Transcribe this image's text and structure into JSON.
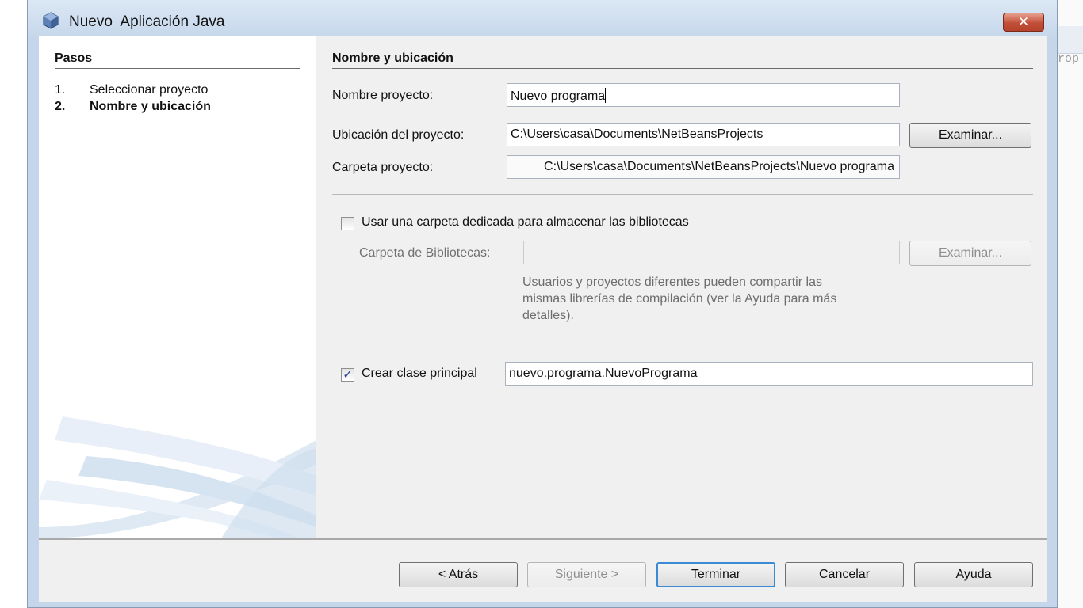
{
  "window": {
    "title": "Nuevo  Aplicación Java",
    "close_label": "✕"
  },
  "steps": {
    "heading": "Pasos",
    "items": [
      {
        "num": "1.",
        "label": "Seleccionar proyecto"
      },
      {
        "num": "2.",
        "label": "Nombre y ubicación"
      }
    ]
  },
  "form": {
    "heading": "Nombre y ubicación",
    "project_name_label": "Nombre proyecto:",
    "project_name_value": "Nuevo programa",
    "location_label": "Ubicación del proyecto:",
    "location_value": "C:\\Users\\casa\\Documents\\NetBeansProjects",
    "browse_label": "Examinar...",
    "folder_label": "Carpeta proyecto:",
    "folder_value": "C:\\Users\\casa\\Documents\\NetBeansProjects\\Nuevo programa",
    "dedicated_folder_label": "Usar una carpeta dedicada para almacenar las bibliotecas",
    "dedicated_folder_checked": false,
    "libraries_label": "Carpeta de Bibliotecas:",
    "libraries_value": "",
    "libraries_browse_label": "Examinar...",
    "hint_lines": [
      "Usuarios y proyectos diferentes pueden compartir las",
      "mismas librerías de compilación (ver la Ayuda para más",
      "detalles)."
    ],
    "main_class_label": "Crear clase principal",
    "main_class_checked": true,
    "main_class_value": "nuevo.programa.NuevoPrograma"
  },
  "buttons": {
    "back": "< Atrás",
    "next": "Siguiente >",
    "finish": "Terminar",
    "cancel": "Cancelar",
    "help": "Ayuda"
  },
  "background": {
    "editor_fragment": "rop"
  },
  "colors": {
    "titlebar": "#c7d8ec",
    "close_button": "#c24f38",
    "default_button_border": "#3a8bd3"
  }
}
